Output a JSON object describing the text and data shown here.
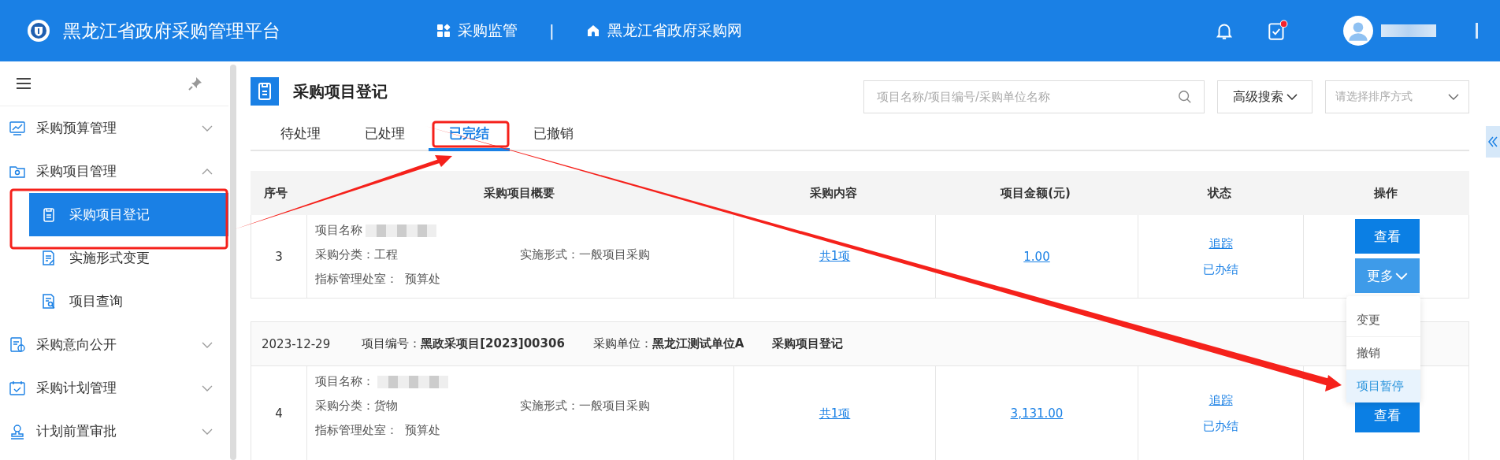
{
  "header": {
    "title": "黑龙江省政府采购管理平台",
    "nav": [
      {
        "label": "采购监管"
      },
      {
        "label": "黑龙江省政府采购网"
      }
    ],
    "separator": "|",
    "has_unread": true
  },
  "sidebar": {
    "items": [
      {
        "label": "采购预算管理",
        "expanded": false
      },
      {
        "label": "采购项目管理",
        "expanded": true,
        "children": [
          {
            "label": "采购项目登记",
            "selected": true
          },
          {
            "label": "实施形式变更",
            "selected": false
          },
          {
            "label": "项目查询",
            "selected": false
          }
        ]
      },
      {
        "label": "采购意向公开",
        "expanded": false
      },
      {
        "label": "采购计划管理",
        "expanded": false
      },
      {
        "label": "计划前置审批",
        "expanded": false
      }
    ]
  },
  "page": {
    "title": "采购项目登记",
    "search": {
      "placeholder": "项目名称/项目编号/采购单位名称"
    },
    "advanced_search": "高级搜索",
    "sort": {
      "placeholder": "请选择排序方式"
    },
    "tabs": [
      {
        "label": "待处理",
        "selected": false
      },
      {
        "label": "已处理",
        "selected": false
      },
      {
        "label": "已完结",
        "selected": true
      },
      {
        "label": "已撤销",
        "selected": false
      }
    ]
  },
  "table": {
    "columns": [
      "序号",
      "采购项目概要",
      "采购内容",
      "项目金额(元)",
      "状态",
      "操作"
    ],
    "rows": [
      {
        "index": "3",
        "name_label": "项目名称",
        "name_redacted": true,
        "category_label": "采购分类：",
        "category": "工程",
        "form_label": "实施形式：",
        "form": "一般项目采购",
        "office_label": "指标管理处室：",
        "office": "预算处",
        "content": "共1项",
        "amount": "1.00",
        "track": "追踪",
        "status": "已办结",
        "actions": [
          {
            "label": "查看",
            "kind": "view"
          },
          {
            "label": "更多",
            "kind": "more"
          }
        ],
        "menu": [
          {
            "label": "变更",
            "selected": false
          },
          {
            "label": "撤销",
            "selected": false
          },
          {
            "label": "项目暂停",
            "selected": true
          }
        ]
      },
      {
        "group": {
          "date": "2023-12-29",
          "code_label": "项目编号：",
          "code": "黑政采项目[2023]00306",
          "unit_label": "采购单位：",
          "unit": "黑龙江测试单位A",
          "stage": "采购项目登记"
        },
        "index": "4",
        "name_label": "项目名称：",
        "name_redacted": true,
        "category_label": "采购分类：",
        "category": "货物",
        "form_label": "实施形式：",
        "form": "一般项目采购",
        "office_label": "指标管理处室：",
        "office": "预算处",
        "content": "共1项",
        "amount": "3,131.00",
        "track": "追踪",
        "status": "已办结",
        "actions": [
          {
            "label": "查看",
            "kind": "view"
          }
        ]
      }
    ]
  }
}
